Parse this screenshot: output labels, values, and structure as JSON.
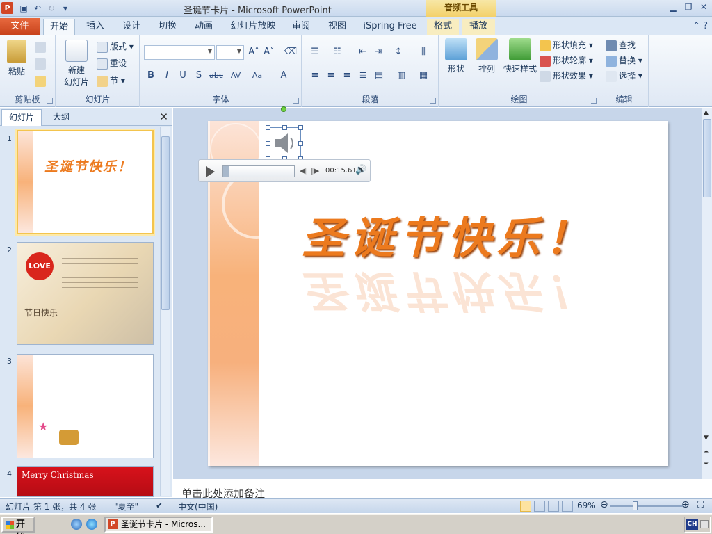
{
  "app": {
    "icon": "P",
    "title": "圣诞节卡片 - Microsoft PowerPoint",
    "context_tab_title": "音频工具"
  },
  "tabs": {
    "file": "文件",
    "items": [
      "开始",
      "插入",
      "设计",
      "切换",
      "动画",
      "幻灯片放映",
      "审阅",
      "视图",
      "iSpring Free",
      "格式",
      "播放"
    ]
  },
  "ribbon": {
    "clipboard": {
      "label": "剪贴板",
      "paste": "粘贴"
    },
    "slides": {
      "label": "幻灯片",
      "new_slide_line1": "新建",
      "new_slide_line2": "幻灯片",
      "layout": "版式",
      "reset": "重设",
      "section": "节"
    },
    "font": {
      "label": "字体"
    },
    "paragraph": {
      "label": "段落"
    },
    "drawing": {
      "label": "绘图",
      "shapes": "形状",
      "arrange": "排列",
      "quick_styles": "快速样式",
      "fill": "形状填充",
      "outline": "形状轮廓",
      "effects": "形状效果"
    },
    "editing": {
      "label": "编辑",
      "find": "查找",
      "replace": "替换",
      "select": "选择"
    }
  },
  "left_panel": {
    "tab_slides": "幻灯片",
    "tab_outline": "大纲",
    "slides": [
      {
        "num": "1",
        "text": "圣诞节快乐！"
      },
      {
        "num": "2",
        "text": "LOVE",
        "subtext": "节日快乐"
      },
      {
        "num": "3",
        "text": ""
      },
      {
        "num": "4",
        "text": "Merry Christmas"
      }
    ]
  },
  "slide": {
    "headline": "圣诞节快乐！",
    "audio_time": "00:15.61",
    "audio_progress": 0.08
  },
  "notes": {
    "placeholder": "单击此处添加备注"
  },
  "status": {
    "slide_info": "幻灯片 第 1 张，共 4 张",
    "theme": "\"夏至\"",
    "language": "中文(中国)",
    "zoom": "69%"
  },
  "taskbar": {
    "start": "开始",
    "task_item": "圣诞节卡片 - Micros...",
    "ime": "CH"
  },
  "colors": {
    "accent_file_tab": "#c8431c",
    "headline_orange": "#ec7a1e",
    "ribbon_bg": "#dfe8f4"
  }
}
